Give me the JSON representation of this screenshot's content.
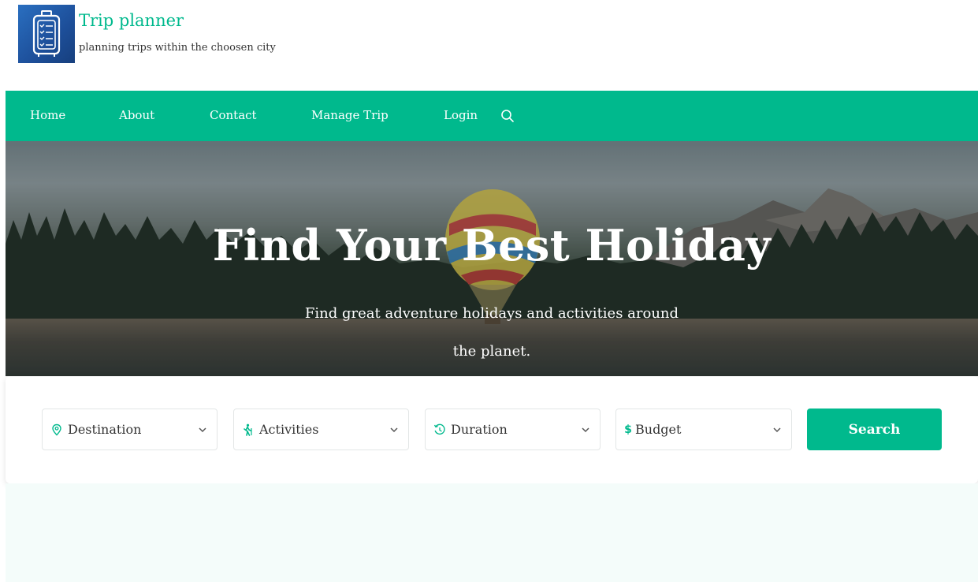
{
  "brand": {
    "title": "Trip planner",
    "tagline": "planning trips within the choosen city",
    "logo_icon": "luggage-checklist-icon"
  },
  "nav": {
    "items": [
      {
        "label": "Home"
      },
      {
        "label": "About"
      },
      {
        "label": "Contact"
      },
      {
        "label": "Manage Trip"
      },
      {
        "label": "Login"
      }
    ],
    "search_icon": "search-icon"
  },
  "hero": {
    "title": "Find Your Best Holiday",
    "subtitle_line1": "Find great adventure holidays and activities around",
    "subtitle_line2": "the planet."
  },
  "search": {
    "fields": [
      {
        "label": "Destination",
        "icon": "map-pin-icon"
      },
      {
        "label": "Activities",
        "icon": "hiking-icon"
      },
      {
        "label": "Duration",
        "icon": "history-icon"
      },
      {
        "label": "Budget",
        "icon": "dollar-icon",
        "glyph": "$"
      }
    ],
    "button_label": "Search"
  },
  "colors": {
    "accent": "#00b98d",
    "logo_bg": "#1d4f9a",
    "bottom_bg": "#f4fcfa"
  }
}
